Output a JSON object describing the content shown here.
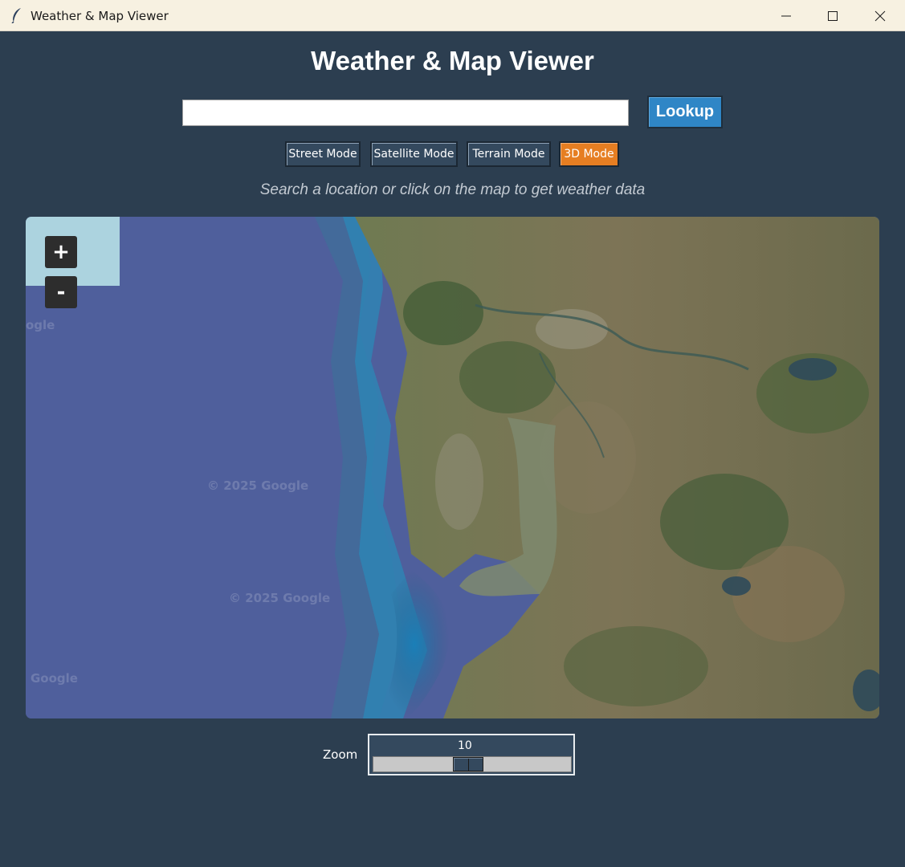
{
  "window": {
    "title": "Weather & Map Viewer"
  },
  "header": {
    "title": "Weather & Map Viewer"
  },
  "search": {
    "value": "",
    "placeholder": "",
    "button_label": "Lookup"
  },
  "modes": [
    {
      "label": "Street Mode",
      "active": false
    },
    {
      "label": "Satellite Mode",
      "active": false
    },
    {
      "label": "Terrain Mode",
      "active": false
    },
    {
      "label": "3D Mode",
      "active": true
    }
  ],
  "hint": "Search a location or click on the map to get weather data",
  "map": {
    "zoom_in_label": "+",
    "zoom_out_label": "-",
    "watermarks": [
      "ogle",
      "© 2025 Google",
      "© 2025 Google",
      "Google"
    ]
  },
  "zoom": {
    "label": "Zoom",
    "value": "10",
    "min": 1,
    "max": 20,
    "current": 10
  },
  "colors": {
    "background": "#2c3e50",
    "accent_active": "#e67e22",
    "lookup_button": "#2f86c6",
    "button": "#34495e"
  }
}
